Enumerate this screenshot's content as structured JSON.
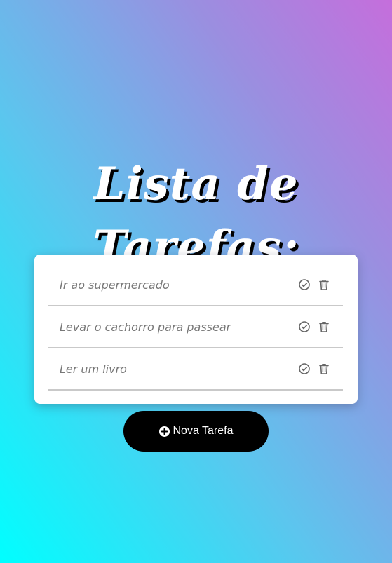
{
  "header": {
    "title": "Lista de Tarefas:"
  },
  "tasks": [
    {
      "text": "Ir ao supermercado",
      "complete_icon": "check-circle-icon",
      "delete_icon": "trash-icon"
    },
    {
      "text": "Levar o cachorro para passear",
      "complete_icon": "check-circle-icon",
      "delete_icon": "trash-icon"
    },
    {
      "text": "Ler um livro",
      "complete_icon": "check-circle-icon",
      "delete_icon": "trash-icon"
    }
  ],
  "actions": {
    "new_task_label": "Nova Tarefa",
    "new_task_icon": "plus-circle-icon"
  },
  "colors": {
    "gradient_start": "#00ffff",
    "gradient_end": "#c56edc",
    "card_bg": "#ffffff",
    "button_bg": "#000000",
    "task_text": "#777777",
    "divider": "#c9c9c9"
  }
}
